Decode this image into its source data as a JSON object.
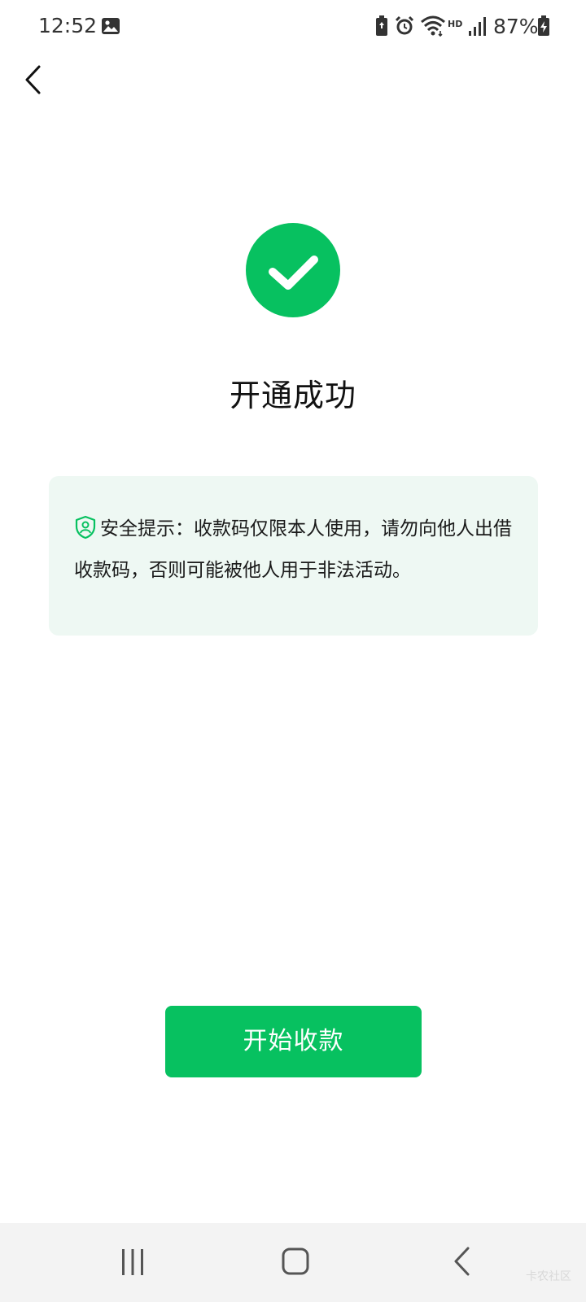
{
  "status_bar": {
    "time": "12:52",
    "battery_percent": "87%",
    "network_label": "HD",
    "icons": [
      "gallery-icon",
      "battery-saver-icon",
      "alarm-icon",
      "wifi-icon",
      "signal-icon",
      "battery-charging-icon"
    ]
  },
  "header": {
    "back_icon": "chevron-left-icon"
  },
  "success": {
    "icon": "check-circle-icon",
    "title": "开通成功"
  },
  "notice": {
    "icon": "shield-icon",
    "text": "安全提示：收款码仅限本人使用，请勿向他人出借收款码，否则可能被他人用于非法活动。"
  },
  "primary_action": {
    "label": "开始收款"
  },
  "nav_bar": {
    "buttons": [
      "recent-apps-icon",
      "home-icon",
      "back-icon"
    ],
    "watermark": "卡农社区"
  },
  "colors": {
    "accent": "#07c160",
    "notice_bg": "#eef8f3",
    "text": "#111111",
    "nav_bg": "#f3f3f3"
  }
}
